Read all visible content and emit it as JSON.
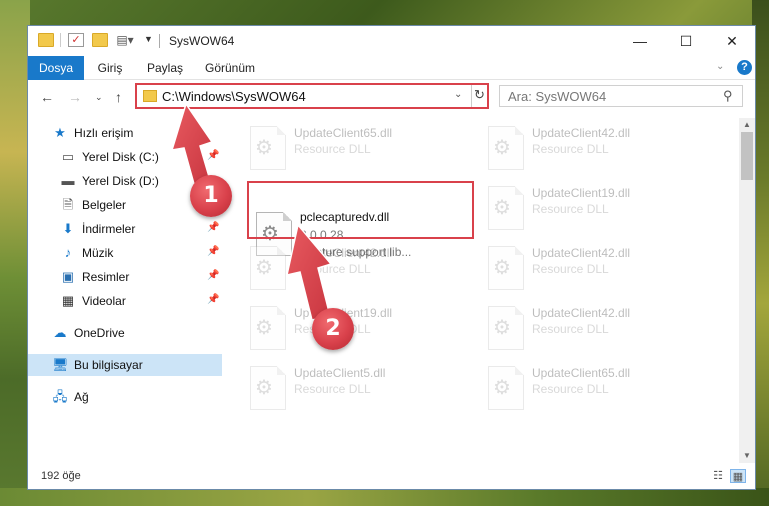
{
  "window": {
    "title": "SysWOW64"
  },
  "window_controls": {
    "minimize": "—",
    "maximize": "☐",
    "close": "✕"
  },
  "ribbon": {
    "tabs": [
      {
        "label": "Dosya",
        "active": true
      },
      {
        "label": "Giriş",
        "active": false
      },
      {
        "label": "Paylaş",
        "active": false
      },
      {
        "label": "Görünüm",
        "active": false
      }
    ],
    "help": "?"
  },
  "address_bar": {
    "path": "C:\\Windows\\SysWOW64"
  },
  "search": {
    "placeholder": "Ara: SysWOW64"
  },
  "sidebar": {
    "items": [
      {
        "label": "Hızlı erişim",
        "icon": "star-icon",
        "pinned": false
      },
      {
        "label": "Yerel Disk (C:)",
        "icon": "drive-icon",
        "pinned": true
      },
      {
        "label": "Yerel Disk (D:)",
        "icon": "drive-icon",
        "pinned": false
      },
      {
        "label": "Belgeler",
        "icon": "documents-icon",
        "pinned": true
      },
      {
        "label": "İndirmeler",
        "icon": "downloads-icon",
        "pinned": true
      },
      {
        "label": "Müzik",
        "icon": "music-icon",
        "pinned": true
      },
      {
        "label": "Resimler",
        "icon": "pictures-icon",
        "pinned": true
      },
      {
        "label": "Videolar",
        "icon": "videos-icon",
        "pinned": true
      },
      {
        "label": "OneDrive",
        "icon": "cloud-icon",
        "pinned": false
      },
      {
        "label": "Bu bilgisayar",
        "icon": "computer-icon",
        "pinned": false,
        "selected": true
      },
      {
        "label": "Ağ",
        "icon": "network-icon",
        "pinned": false
      }
    ]
  },
  "files": [
    {
      "name": "UpdateClient65.dll",
      "line2": "Resource DLL",
      "faded": true
    },
    {
      "name": "UpdateClient42.dll",
      "line2": "Resource DLL",
      "faded": true
    },
    {
      "name": "pclecapturedv.dll",
      "line2": "2.0.0.28",
      "line3": "Capture support lib...",
      "faded": false,
      "highlighted": true
    },
    {
      "name": "UpdateClient19.dll",
      "line2": "Resource DLL",
      "faded": true
    },
    {
      "name": "UpdateClient42.dll",
      "line2": "Resource DLL",
      "faded": true
    },
    {
      "name": "UpdateClient42.dll",
      "line2": "Resource DLL",
      "faded": true
    },
    {
      "name": "UpdateClient19.dll",
      "line2": "Resource DLL",
      "faded": true
    },
    {
      "name": "UpdateClient42.dll",
      "line2": "Resource DLL",
      "faded": true
    },
    {
      "name": "UpdateClient5.dll",
      "line2": "Resource DLL",
      "faded": true
    },
    {
      "name": "UpdateClient65.dll",
      "line2": "Resource DLL",
      "faded": true
    }
  ],
  "status": {
    "item_count": "192 öğe"
  },
  "annotations": {
    "step1": "1",
    "step2": "2"
  },
  "colors": {
    "accent": "#1979ca",
    "annotation": "#d9414b",
    "selection": "#cce4f7"
  }
}
